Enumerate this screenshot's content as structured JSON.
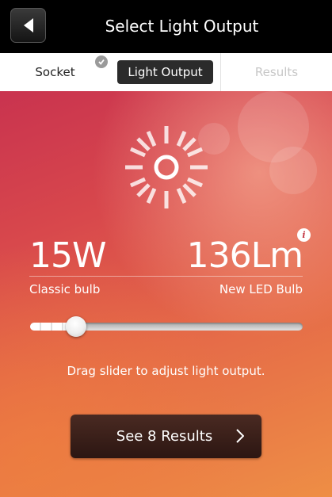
{
  "header": {
    "title": "Select Light Output",
    "back_icon": "back-arrow-icon"
  },
  "tabs": [
    {
      "label": "Socket",
      "state": "completed"
    },
    {
      "label": "Light Output",
      "state": "active"
    },
    {
      "label": "Results",
      "state": "disabled"
    }
  ],
  "output": {
    "watts": "15W",
    "lumens": "136Lm",
    "classic_label": "Classic bulb",
    "led_label": "New LED Bulb",
    "info_icon": "i"
  },
  "slider": {
    "value_fraction": 0.17
  },
  "hint": "Drag slider to adjust light output.",
  "results_button": {
    "label": "See 8 Results"
  },
  "colors": {
    "accent": "#d8484c",
    "header_bg": "#000000"
  }
}
